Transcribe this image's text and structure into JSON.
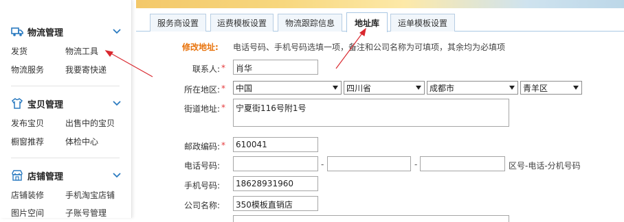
{
  "sidebar": {
    "logistics": {
      "title": "物流管理",
      "icon": "truck-icon",
      "links": [
        "发货",
        "物流工具",
        "物流服务",
        "我要寄快递"
      ]
    },
    "goods": {
      "title": "宝贝管理",
      "icon": "shirt-icon",
      "links": [
        "发布宝贝",
        "出售中的宝贝",
        "橱窗推荐",
        "体检中心"
      ]
    },
    "shop": {
      "title": "店铺管理",
      "icon": "store-icon",
      "links": [
        "店铺装修",
        "手机淘宝店铺",
        "图片空间",
        "子账号管理"
      ]
    }
  },
  "tabs": [
    "服务商设置",
    "运费模板设置",
    "物流跟踪信息",
    "地址库",
    "运单模板设置"
  ],
  "form": {
    "heading": "修改地址:",
    "note": "电话号码、手机号码选填一项，备注和公司名称为可填项，其余均为必填项",
    "contact_label": "联系人:",
    "contact_value": "肖华",
    "region_label": "所在地区:",
    "country": "中国",
    "province": "四川省",
    "city": "成都市",
    "district": "青羊区",
    "street_label": "街道地址:",
    "street_value": "宁夏街116号附1号",
    "zip_label": "邮政编码:",
    "zip_value": "610041",
    "phone_label": "电话号码:",
    "phone_area": "",
    "phone_number": "",
    "phone_ext": "",
    "phone_hint": "区号-电话-分机号码",
    "mobile_label": "手机号码:",
    "mobile_value": "18628931960",
    "company_label": "公司名称:",
    "company_value": "350模板直销店",
    "required_mark": "*",
    "dash": "-"
  },
  "colors": {
    "accent_orange": "#e8730c",
    "required_red": "#e4393c",
    "annotation_red": "#d9282f",
    "icon_blue": "#2a7ac0"
  }
}
